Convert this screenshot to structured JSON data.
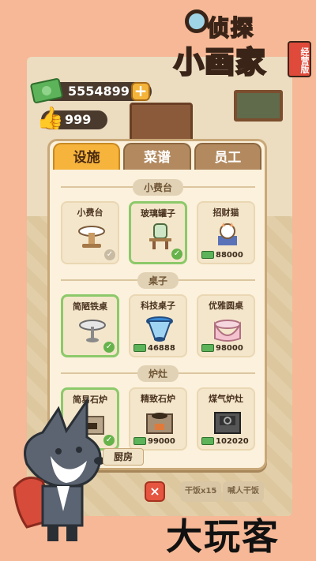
{
  "logo": {
    "line1": "侦探",
    "line2": "小画家",
    "badge": "经营版"
  },
  "currency": {
    "money": "5554899",
    "likes": "999",
    "plus_label": "+"
  },
  "tabs": [
    {
      "label": "设施",
      "active": true
    },
    {
      "label": "菜谱",
      "active": false
    },
    {
      "label": "员工",
      "active": false
    }
  ],
  "sections": [
    {
      "title": "小费台",
      "items": [
        {
          "name": "小费台",
          "owned": false,
          "price": ""
        },
        {
          "name": "玻璃罐子",
          "owned": true,
          "price": ""
        },
        {
          "name": "招财猫",
          "owned": false,
          "price": "88000"
        }
      ]
    },
    {
      "title": "桌子",
      "items": [
        {
          "name": "简陋铁桌",
          "owned": true,
          "price": ""
        },
        {
          "name": "科技桌子",
          "owned": false,
          "price": "46888"
        },
        {
          "name": "优雅圆桌",
          "owned": false,
          "price": "98000"
        }
      ]
    },
    {
      "title": "炉灶",
      "items": [
        {
          "name": "简易石炉",
          "owned": true,
          "price": ""
        },
        {
          "name": "精致石炉",
          "owned": false,
          "price": "99000"
        },
        {
          "name": "煤气炉灶",
          "owned": false,
          "price": "102020"
        }
      ]
    }
  ],
  "kitchen_label": "厨房",
  "close_label": "×",
  "bottom_buttons": [
    "干饭x15",
    "喊人干饭"
  ],
  "watermark": "大玩客",
  "icons": {
    "money": "cash-icon",
    "likes": "thumbs-up-icon",
    "check": "check-icon"
  },
  "colors": {
    "active_tab": "#f6b43c",
    "owned_border": "#8cc96a",
    "check": "#67b34b",
    "close": "#e5553f"
  }
}
